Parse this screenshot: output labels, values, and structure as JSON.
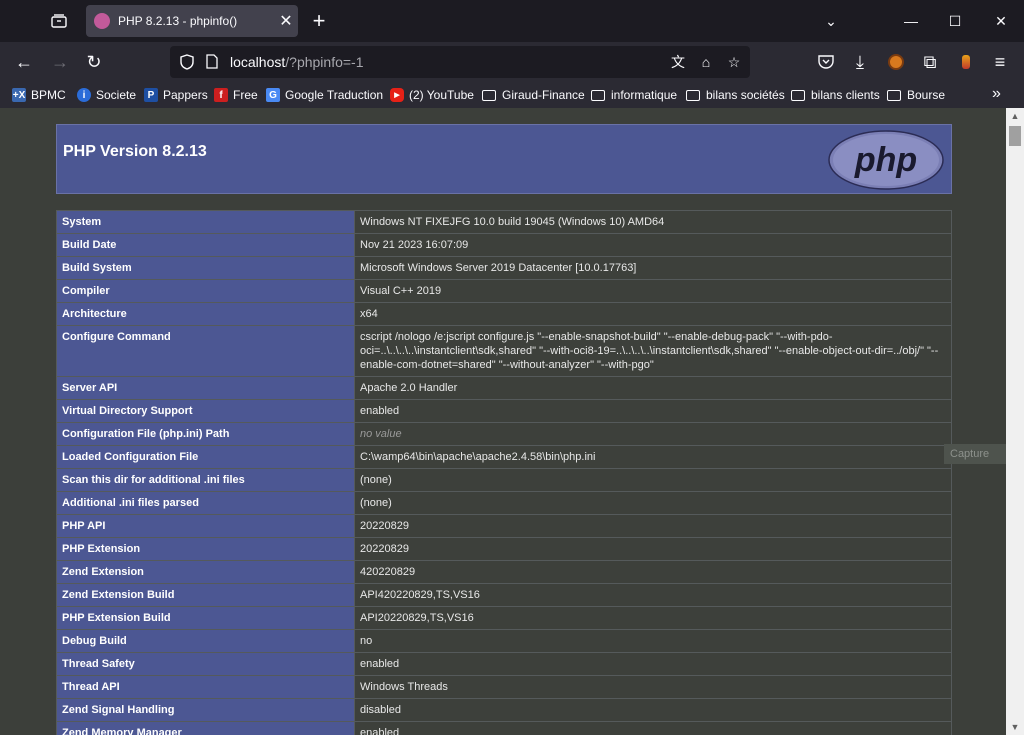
{
  "browser": {
    "tab": {
      "title": "PHP 8.2.13 - phpinfo()",
      "favicon": "php-favicon-icon"
    },
    "url": {
      "host": "localhost",
      "rest": "/?phpinfo=-1"
    },
    "bookmarks": [
      {
        "label": "BPMC",
        "icon": "bpmc-icon"
      },
      {
        "label": "Societe",
        "icon": "info-icon"
      },
      {
        "label": "Pappers",
        "icon": "pappers-icon"
      },
      {
        "label": "Free",
        "icon": "free-icon"
      },
      {
        "label": "Google Traduction",
        "icon": "google-translate-icon"
      },
      {
        "label": "(2) YouTube",
        "icon": "youtube-icon"
      },
      {
        "label": "Giraud-Finance",
        "icon": "folder-icon"
      },
      {
        "label": "informatique",
        "icon": "folder-icon"
      },
      {
        "label": "bilans sociétés",
        "icon": "folder-icon"
      },
      {
        "label": "bilans clients",
        "icon": "folder-icon"
      },
      {
        "label": "Bourse",
        "icon": "folder-icon"
      }
    ]
  },
  "page": {
    "title": "PHP Version 8.2.13",
    "logo_text": "php",
    "capture_badge": "Capture",
    "rows": [
      {
        "key": "System",
        "value": "Windows NT FIXEJFG 10.0 build 19045 (Windows 10) AMD64"
      },
      {
        "key": "Build Date",
        "value": "Nov 21 2023 16:07:09"
      },
      {
        "key": "Build System",
        "value": "Microsoft Windows Server 2019 Datacenter [10.0.17763]"
      },
      {
        "key": "Compiler",
        "value": "Visual C++ 2019"
      },
      {
        "key": "Architecture",
        "value": "x64"
      },
      {
        "key": "Configure Command",
        "value": "cscript /nologo /e:jscript configure.js \"--enable-snapshot-build\" \"--enable-debug-pack\" \"--with-pdo-oci=..\\..\\..\\..\\instantclient\\sdk,shared\" \"--with-oci8-19=..\\..\\..\\..\\instantclient\\sdk,shared\" \"--enable-object-out-dir=../obj/\" \"--enable-com-dotnet=shared\" \"--without-analyzer\" \"--with-pgo\""
      },
      {
        "key": "Server API",
        "value": "Apache 2.0 Handler"
      },
      {
        "key": "Virtual Directory Support",
        "value": "enabled"
      },
      {
        "key": "Configuration File (php.ini) Path",
        "value": "no value",
        "novalue": true
      },
      {
        "key": "Loaded Configuration File",
        "value": "C:\\wamp64\\bin\\apache\\apache2.4.58\\bin\\php.ini"
      },
      {
        "key": "Scan this dir for additional .ini files",
        "value": "(none)"
      },
      {
        "key": "Additional .ini files parsed",
        "value": "(none)"
      },
      {
        "key": "PHP API",
        "value": "20220829"
      },
      {
        "key": "PHP Extension",
        "value": "20220829"
      },
      {
        "key": "Zend Extension",
        "value": "420220829"
      },
      {
        "key": "Zend Extension Build",
        "value": "API420220829,TS,VS16"
      },
      {
        "key": "PHP Extension Build",
        "value": "API20220829,TS,VS16"
      },
      {
        "key": "Debug Build",
        "value": "no"
      },
      {
        "key": "Thread Safety",
        "value": "enabled"
      },
      {
        "key": "Thread API",
        "value": "Windows Threads"
      },
      {
        "key": "Zend Signal Handling",
        "value": "disabled"
      },
      {
        "key": "Zend Memory Manager",
        "value": "enabled"
      }
    ]
  },
  "colors": {
    "header_bg": "#4c5793",
    "key_bg": "#4c5793",
    "value_bg": "#3d403b",
    "page_bg": "#3c3f3a"
  }
}
